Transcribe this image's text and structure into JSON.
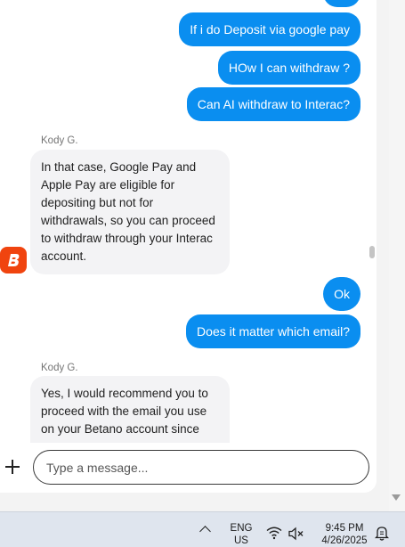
{
  "conversation": {
    "outgoing_top": [
      "If i do Deposit via google pay",
      "HOw I can withdraw ?",
      "Can AI withdraw to Interac?"
    ],
    "agent_name_1": "Kody G.",
    "agent_msg_1": "In that case, Google Pay and Apple Pay are eligible for depositing but not for withdrawals, so you can proceed to withdraw through your Interac account.",
    "outgoing_mid": [
      "Ok",
      "Does it matter which email?"
    ],
    "agent_name_2": "Kody G.",
    "agent_msg_2": "Yes, I would recommend you to proceed with the email you use on your Betano account since"
  },
  "avatar": {
    "letter": "B",
    "color": "#f0440f"
  },
  "composer": {
    "placeholder": "Type a message...",
    "add_icon": "plus-icon"
  },
  "taskbar": {
    "lang_top": "ENG",
    "lang_bottom": "US",
    "time": "9:45 PM",
    "date": "4/26/2025",
    "icons": [
      "chevron-up-icon",
      "wifi-icon",
      "speaker-muted-icon",
      "notification-icon"
    ]
  },
  "colors": {
    "accent": "#0a8ef0",
    "incoming_bg": "#f3f3f5",
    "brand": "#f0440f"
  }
}
